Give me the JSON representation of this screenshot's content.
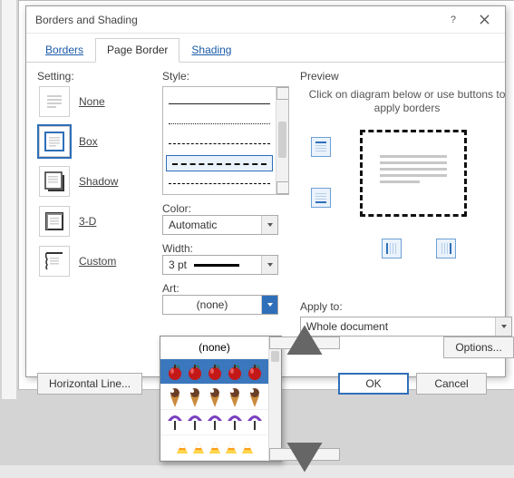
{
  "title": "Borders and Shading",
  "tabs": [
    "Borders",
    "Page Border",
    "Shading"
  ],
  "active_tab": "Page Border",
  "setting": {
    "label": "Setting:",
    "options": [
      "None",
      "Box",
      "Shadow",
      "3-D",
      "Custom"
    ],
    "selected": "Box"
  },
  "style": {
    "label": "Style:",
    "selected_index": 3
  },
  "color": {
    "label": "Color:",
    "value": "Automatic"
  },
  "width": {
    "label": "Width:",
    "value": "3 pt"
  },
  "art": {
    "label": "Art:",
    "value": "(none)",
    "options": [
      "(none)",
      "apples",
      "ice-cream-cones",
      "umbrellas",
      "candy-corn"
    ],
    "dropdown_open": true,
    "highlighted_index": 1
  },
  "preview": {
    "label": "Preview",
    "hint": "Click on diagram below or use buttons to apply borders"
  },
  "apply": {
    "label": "Apply to:",
    "value": "Whole document"
  },
  "buttons": {
    "options": "Options...",
    "horizontal_line": "Horizontal Line...",
    "ok": "OK",
    "cancel": "Cancel"
  }
}
